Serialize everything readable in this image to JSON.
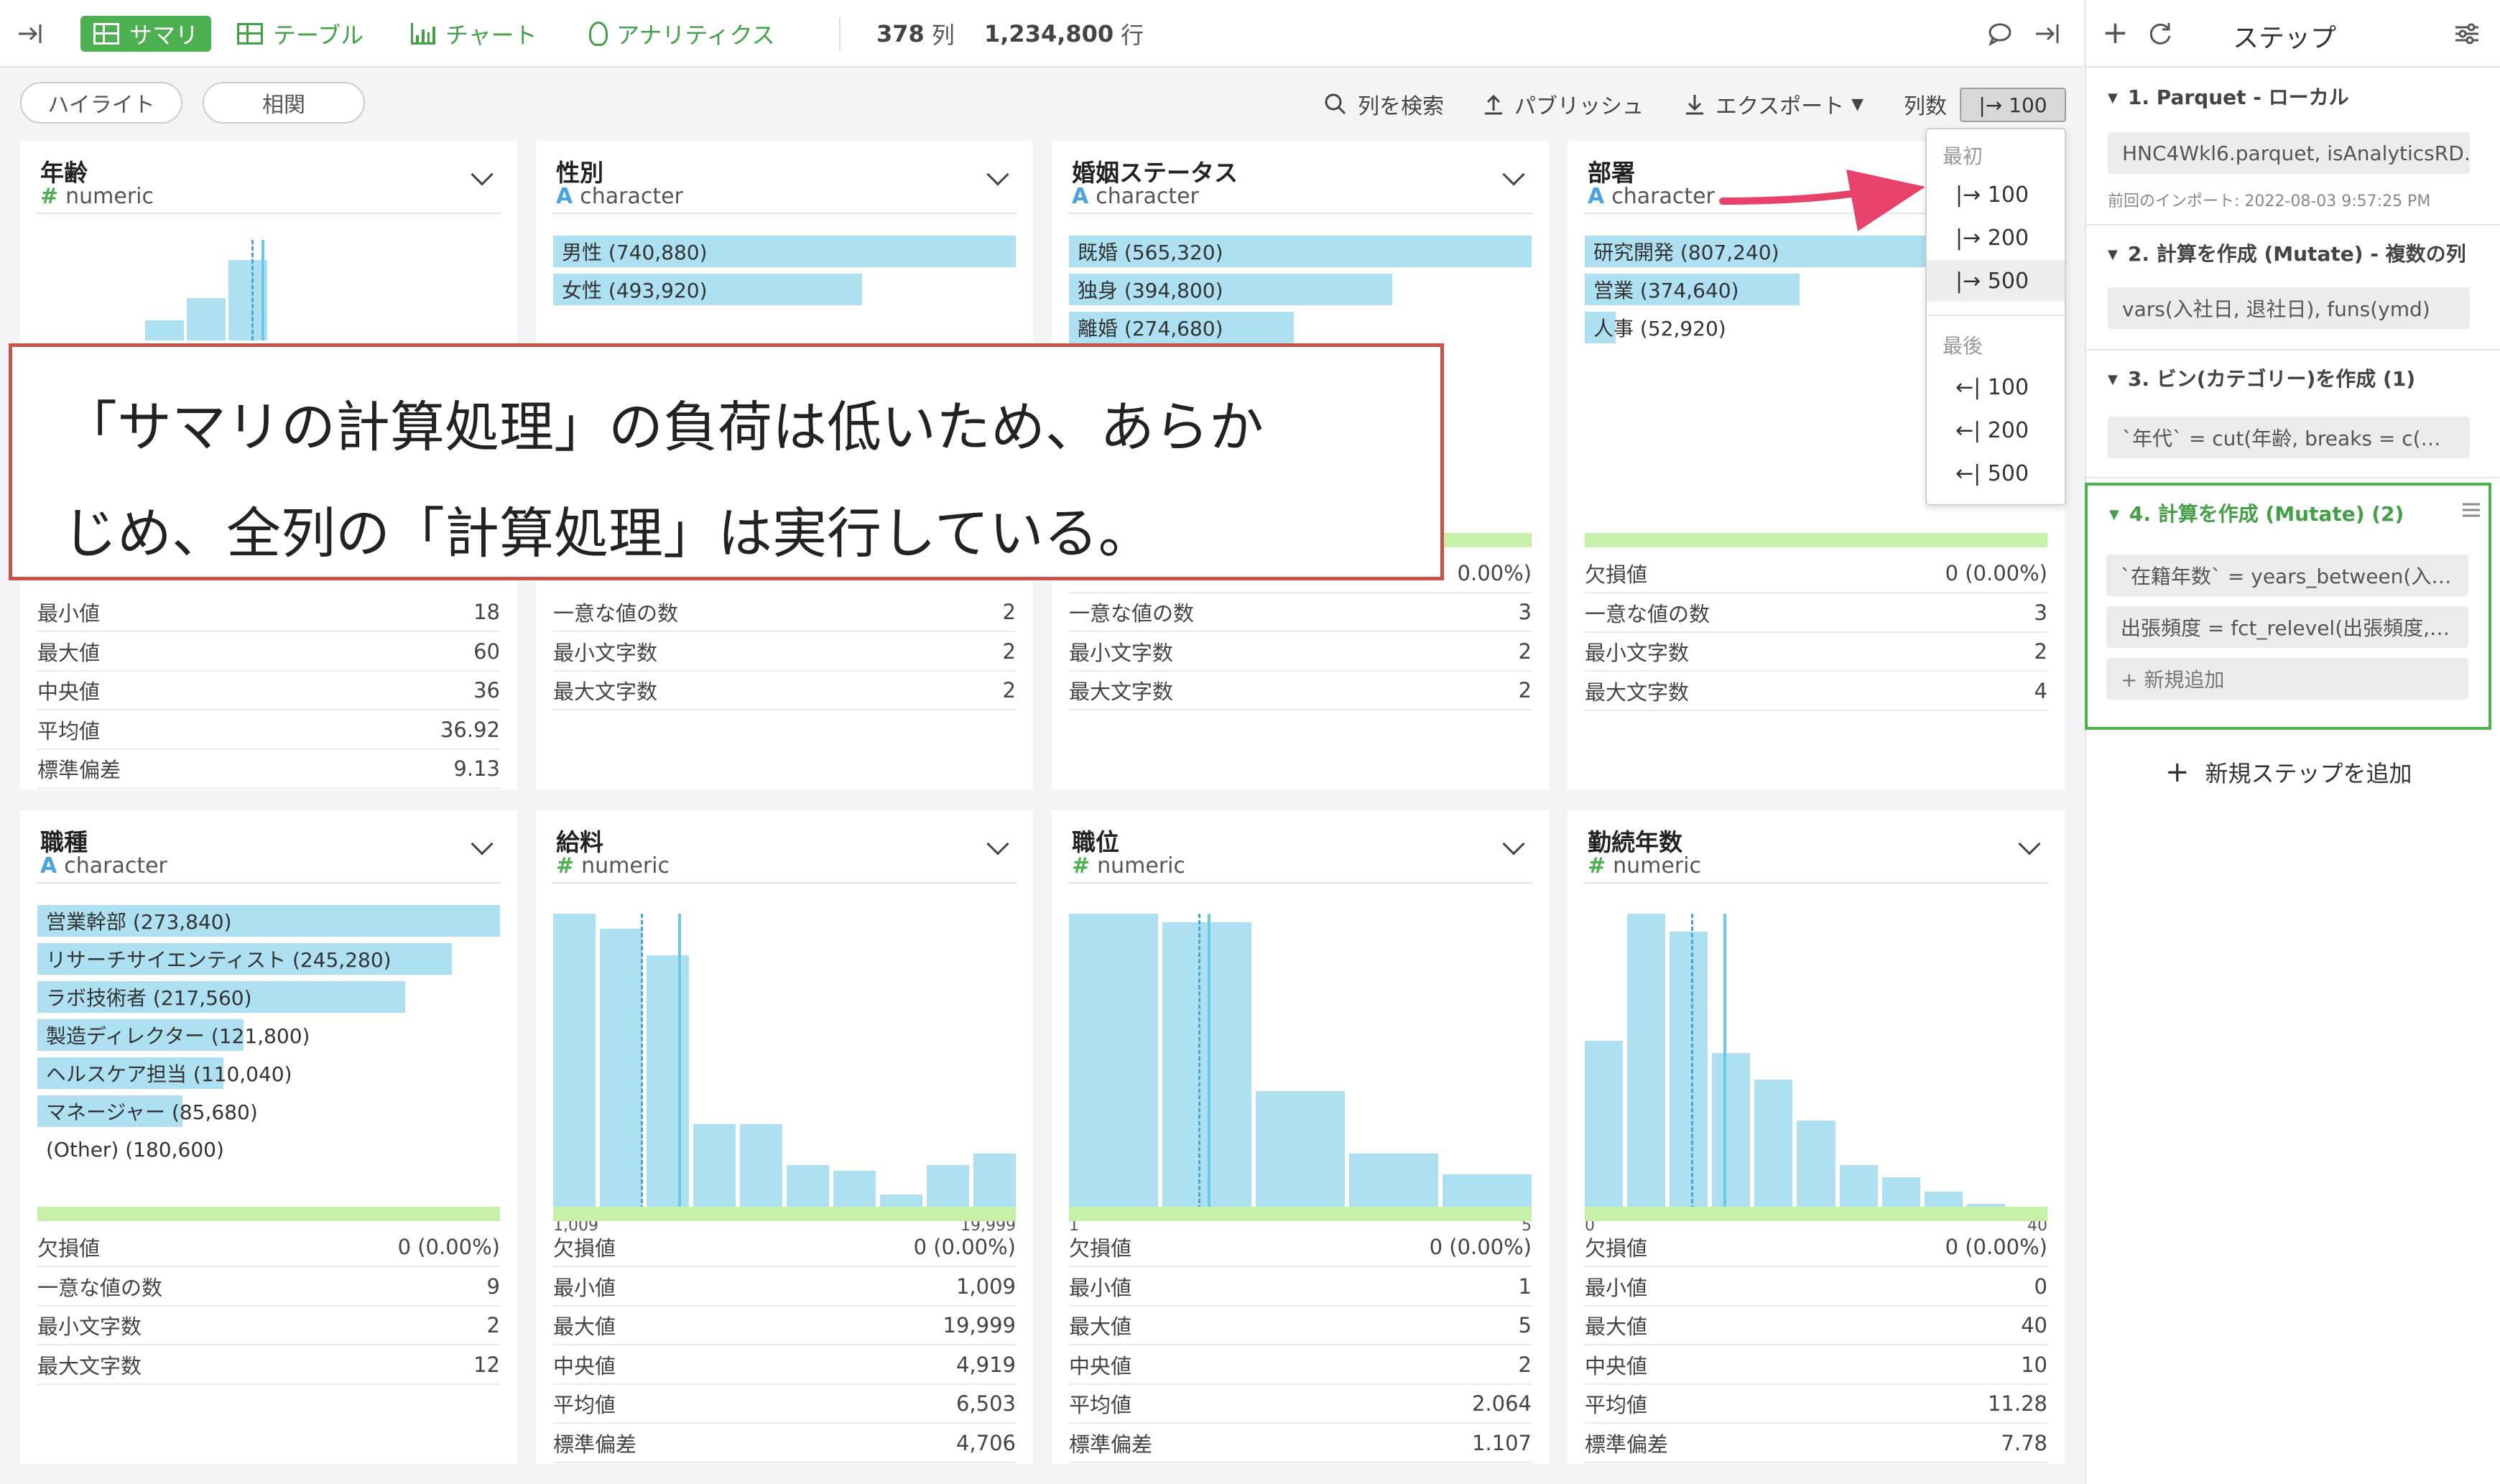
{
  "topbar": {
    "tabs": [
      {
        "label": "サマリ",
        "icon": "grid-icon",
        "active": true
      },
      {
        "label": "テーブル",
        "icon": "table-icon",
        "active": false
      },
      {
        "label": "チャート",
        "icon": "bar-chart-icon",
        "active": false
      },
      {
        "label": "アナリティクス",
        "icon": "lightbulb-icon",
        "active": false
      }
    ],
    "columns_count": "378",
    "columns_label": "列",
    "rows_count": "1,234,800",
    "rows_label": "行"
  },
  "toolbar": {
    "highlight": "ハイライト",
    "correlation": "相関",
    "search_columns": "列を検索",
    "publish": "パブリッシュ",
    "export": "エクスポート",
    "columns_label": "列数",
    "columns_value": "|→ 100"
  },
  "dropdown": {
    "first_header": "最初",
    "first_items": [
      "|→ 100",
      "|→ 200",
      "|→ 500"
    ],
    "last_header": "最後",
    "last_items": [
      "←| 100",
      "←| 200",
      "←| 500"
    ]
  },
  "callout": {
    "line1": "「サマリの計算処理」の負荷は低いため、あらか",
    "line2": "じめ、全列の「計算処理」は実行している。"
  },
  "cards": [
    {
      "title": "年齢",
      "type": "numeric",
      "stats": [
        [
          "最小値",
          "18"
        ],
        [
          "最大値",
          "60"
        ],
        [
          "中央値",
          "36"
        ],
        [
          "平均値",
          "36.92"
        ],
        [
          "標準偏差",
          "9.13"
        ]
      ]
    },
    {
      "title": "性別",
      "type": "character",
      "bars": [
        {
          "label": "男性 (740,880)",
          "frac": 1.0
        },
        {
          "label": "女性 (493,920)",
          "frac": 0.667
        }
      ],
      "stats": [
        [
          "一意な値の数",
          "2"
        ],
        [
          "最小文字数",
          "2"
        ],
        [
          "最大文字数",
          "2"
        ]
      ]
    },
    {
      "title": "婚姻ステータス",
      "type": "character",
      "bars": [
        {
          "label": "既婚 (565,320)",
          "frac": 1.0
        },
        {
          "label": "独身 (394,800)",
          "frac": 0.698
        },
        {
          "label": "離婚 (274,680)",
          "frac": 0.486
        }
      ],
      "missing_value": "0.00%)",
      "stats": [
        [
          "一意な値の数",
          "3"
        ],
        [
          "最小文字数",
          "2"
        ],
        [
          "最大文字数",
          "2"
        ]
      ]
    },
    {
      "title": "部署",
      "type": "character",
      "bars": [
        {
          "label": "研究開発 (807,240)",
          "frac": 1.0
        },
        {
          "label": "営業 (374,640)",
          "frac": 0.464
        },
        {
          "label": "人事 (52,920)",
          "frac": 0.066
        }
      ],
      "stats": [
        [
          "欠損値",
          "0 (0.00%)"
        ],
        [
          "一意な値の数",
          "3"
        ],
        [
          "最小文字数",
          "2"
        ],
        [
          "最大文字数",
          "4"
        ]
      ]
    },
    {
      "title": "職種",
      "type": "character",
      "bars": [
        {
          "label": "営業幹部 (273,840)",
          "frac": 1.0
        },
        {
          "label": "リサーチサイエンティスト (245,280)",
          "frac": 0.896
        },
        {
          "label": "ラボ技術者 (217,560)",
          "frac": 0.795
        },
        {
          "label": "製造ディレクター (121,800)",
          "frac": 0.445
        },
        {
          "label": "ヘルスケア担当 (110,040)",
          "frac": 0.402
        },
        {
          "label": "マネージャー (85,680)",
          "frac": 0.313
        },
        {
          "label": "(Other) (180,600)",
          "frac": 0.0
        }
      ],
      "stats": [
        [
          "欠損値",
          "0 (0.00%)"
        ],
        [
          "一意な値の数",
          "9"
        ],
        [
          "最小文字数",
          "2"
        ],
        [
          "最大文字数",
          "12"
        ]
      ]
    },
    {
      "title": "給料",
      "type": "numeric",
      "axis_min": "1,009",
      "axis_max": "19,999",
      "hist": [
        1.0,
        0.95,
        0.86,
        0.29,
        0.29,
        0.15,
        0.13,
        0.05,
        0.15,
        0.19
      ],
      "stats": [
        [
          "欠損値",
          "0 (0.00%)"
        ],
        [
          "最小値",
          "1,009"
        ],
        [
          "最大値",
          "19,999"
        ],
        [
          "中央値",
          "4,919"
        ],
        [
          "平均値",
          "6,503"
        ],
        [
          "標準偏差",
          "4,706"
        ]
      ]
    },
    {
      "title": "職位",
      "type": "numeric",
      "axis_min": "1",
      "axis_max": "5",
      "hist": [
        1.0,
        0.97,
        0.4,
        0.19,
        0.12
      ],
      "stats": [
        [
          "欠損値",
          "0 (0.00%)"
        ],
        [
          "最小値",
          "1"
        ],
        [
          "最大値",
          "5"
        ],
        [
          "中央値",
          "2"
        ],
        [
          "平均値",
          "2.064"
        ],
        [
          "標準偏差",
          "1.107"
        ]
      ]
    },
    {
      "title": "勤続年数",
      "type": "numeric",
      "axis_min": "0",
      "axis_max": "40",
      "hist": [
        0.57,
        1.0,
        0.94,
        0.53,
        0.44,
        0.3,
        0.15,
        0.11,
        0.06,
        0.02,
        0.01
      ],
      "stats": [
        [
          "欠損値",
          "0 (0.00%)"
        ],
        [
          "最小値",
          "0"
        ],
        [
          "最大値",
          "40"
        ],
        [
          "中央値",
          "10"
        ],
        [
          "平均値",
          "11.28"
        ],
        [
          "標準偏差",
          "7.78"
        ]
      ]
    }
  ],
  "age_hist": [
    0.2,
    0.42,
    0.8
  ],
  "panel": {
    "title": "ステップ",
    "steps": [
      {
        "title": "1. Parquet - ローカル",
        "boxes": [
          "HNC4Wkl6.parquet, isAnalyticsRD…"
        ],
        "note": "前回のインポート: 2022-08-03 9:57:25 PM"
      },
      {
        "title": "2. 計算を作成 (Mutate) - 複数の列",
        "boxes": [
          "vars(入社日, 退社日), funs(ymd)"
        ]
      },
      {
        "title": "3. ビン(カテゴリー)を作成 (1)",
        "boxes": [
          "`年代` = cut(年齢, breaks = c(…"
        ]
      },
      {
        "title": "4. 計算を作成 (Mutate) (2)",
        "boxes": [
          "`在籍年数` = years_between(入…",
          "出張頻度 = fct_relevel(出張頻度,…"
        ],
        "add_new": "+ 新規追加"
      }
    ],
    "add_step": "新規ステップを追加"
  },
  "colors": {
    "accent": "#4caf50",
    "bar": "#ade0f0",
    "callout_border": "#c9524a",
    "arrow": "#e8416a"
  }
}
